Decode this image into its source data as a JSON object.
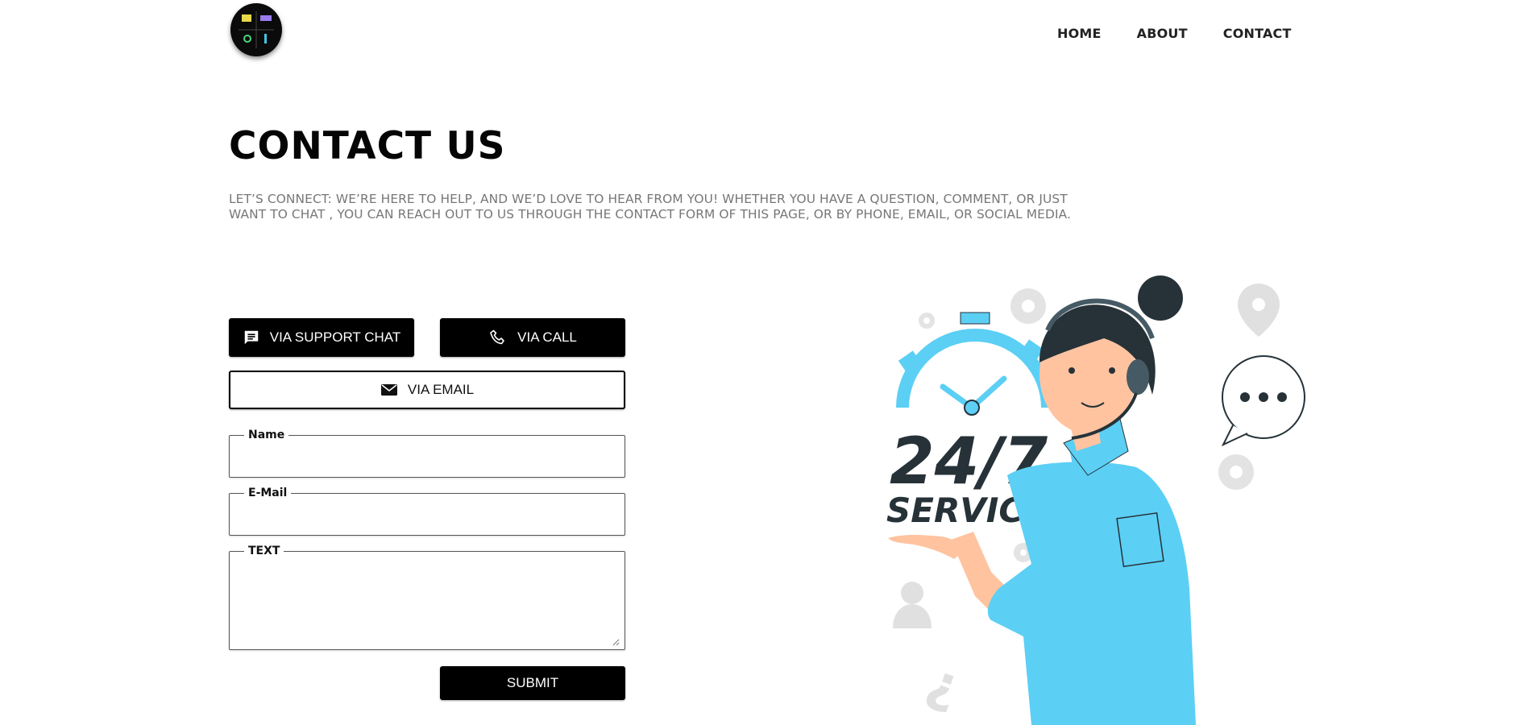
{
  "header": {
    "logo_icon": "logo-icon",
    "nav": [
      {
        "label": "HOME"
      },
      {
        "label": "ABOUT"
      },
      {
        "label": "CONTACT"
      }
    ]
  },
  "main": {
    "title": "CONTACT US",
    "intro": "LET’S CONNECT: WE’RE HERE TO HELP, AND WE’D LOVE TO HEAR FROM YOU! WHETHER YOU HAVE A QUESTION, COMMENT, OR JUST WANT TO CHAT , YOU CAN REACH OUT TO US THROUGH THE CONTACT FORM OF THIS PAGE, OR BY PHONE, EMAIL, OR SOCIAL MEDIA."
  },
  "contact_buttons": {
    "chat_label": "VIA SUPPORT CHAT",
    "chat_icon": "chat-icon",
    "call_label": "VIA CALL",
    "call_icon": "phone-icon",
    "email_label": "VIA EMAIL",
    "email_icon": "mail-icon"
  },
  "form": {
    "name_label": "Name",
    "name_value": "",
    "email_label": "E-Mail",
    "email_value": "",
    "text_label": "TEXT",
    "text_value": "",
    "submit_label": "SUBMIT"
  },
  "illustration": {
    "badge_number": "24/7",
    "badge_word": "SERVICE",
    "colors": {
      "accent_blue": "#5ccff5",
      "dark": "#263238",
      "skin": "#ffc3a0",
      "gray": "#e0e0e0"
    }
  }
}
